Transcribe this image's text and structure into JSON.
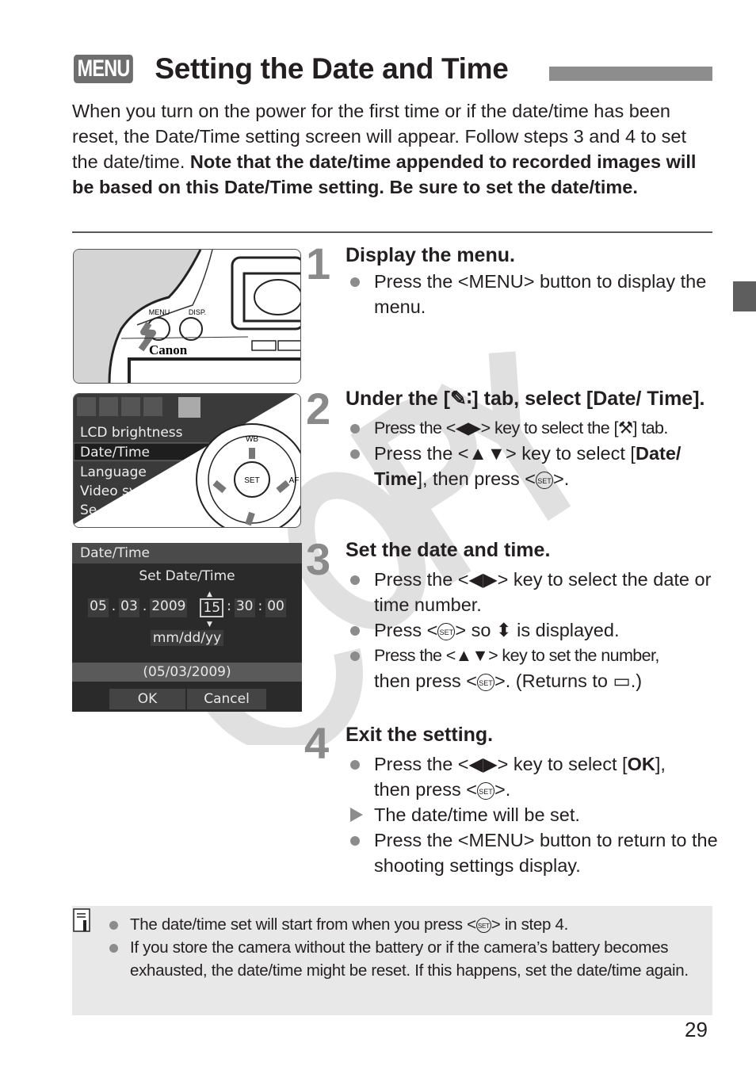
{
  "header": {
    "menu_badge": "MENU",
    "title": "Setting the Date and Time"
  },
  "intro": {
    "text_plain": "When you turn on the power for the first time or if the date/time has been reset, the Date/Time setting screen will appear. Follow steps 3 and 4 to set the date/time. ",
    "text_bold": "Note that the date/time appended to recorded images will be based on this Date/Time setting. Be sure to set the date/time."
  },
  "watermark": "COPY",
  "steps": [
    {
      "number": "1",
      "heading": "Display the menu.",
      "bullets": [
        {
          "type": "dot",
          "parts": [
            "Press the <MENU> button to display the menu."
          ]
        }
      ],
      "image": {
        "labels": [
          "MENU",
          "DISP.",
          "Canon"
        ]
      }
    },
    {
      "number": "2",
      "heading": "Under the [ƒ∶] tab, select [Date/ Time].",
      "heading_parts": [
        "Under the [",
        "∶] tab, select [Date/ Time]."
      ],
      "bullets": [
        {
          "type": "dot",
          "text": "Press the <◀▶> key to select the [⚒] tab."
        },
        {
          "type": "dot",
          "text_a": "Press the <▲▼> key to select [",
          "text_bold_a": "Date/ Time",
          "text_b": "], then press <",
          "text_c": ">."
        }
      ],
      "image": {
        "menu_items": [
          "LCD brightness",
          "Date/Time",
          "Language",
          "Video sy...",
          "Se..."
        ],
        "selected_item": "Date/Time",
        "dial_labels": [
          "WB",
          "SET",
          "AF"
        ]
      }
    },
    {
      "number": "3",
      "heading": "Set the date and time.",
      "bullets": [
        {
          "type": "dot",
          "text": "Press the <◀▶> key to select the date or time number."
        },
        {
          "type": "dot",
          "text_a": "Press <",
          "text_b": "> so ⬍ is displayed."
        },
        {
          "type": "dot",
          "text_a": "Press the <▲▼> key to set the number,",
          "text_b": "then press <",
          "text_c": ">. (Returns to ▭.)"
        }
      ],
      "image": {
        "screen_title": "Date/Time",
        "subtitle": "Set Date/Time",
        "month": "05",
        "day": "03",
        "year": "2009",
        "hour": "15",
        "minute": "30",
        "second": "00",
        "format": "mm/dd/yy",
        "preview": "(05/03/2009)",
        "ok": "OK",
        "cancel": "Cancel"
      }
    },
    {
      "number": "4",
      "heading": "Exit the setting.",
      "bullets": [
        {
          "type": "dot",
          "text_a": "Press the <◀▶> key to select [",
          "text_bold": "OK",
          "text_b": "],",
          "text_c": "then press <",
          "text_d": ">."
        },
        {
          "type": "arrow",
          "text": "The date/time will be set."
        },
        {
          "type": "dot",
          "text": "Press the <MENU> button to return to the shooting settings display."
        }
      ]
    }
  ],
  "notes": {
    "items": [
      {
        "text_a": "The date/time set will start from when you press <",
        "text_b": "> in step 4."
      },
      {
        "text": "If you store the camera without the battery or if the camera’s battery becomes exhausted, the date/time might be reset. If this happens, set the date/time again."
      }
    ]
  },
  "set_icon_label": "SET",
  "page_number": "29",
  "colors": {
    "text": "#231f20",
    "accent_gray": "#8d8d8d",
    "note_bg": "#e8e8e8",
    "watermark": "#d9d9d9"
  }
}
